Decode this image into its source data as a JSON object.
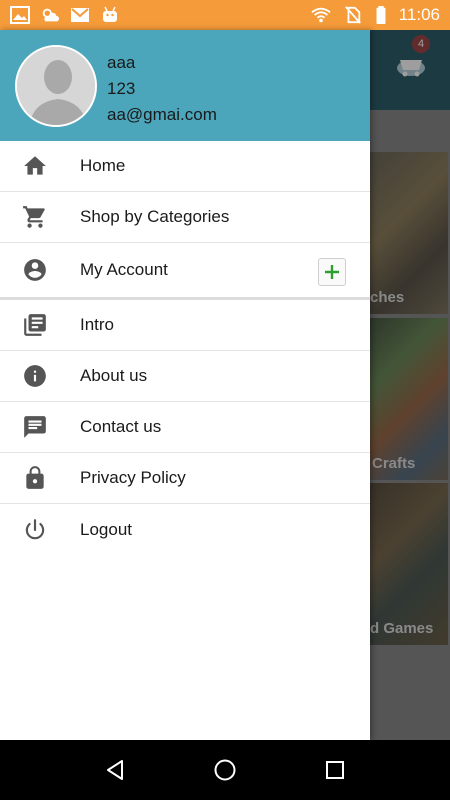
{
  "status_bar": {
    "time": "11:06",
    "left_icons": [
      "image-icon",
      "weather-icon",
      "gmail-icon",
      "android-icon"
    ],
    "right_icons": [
      "wifi-icon",
      "no-sim-icon",
      "battery-icon"
    ],
    "color": "#f59b3a"
  },
  "background_app": {
    "cart_badge": "4",
    "tiles": [
      {
        "label": "ches"
      },
      {
        "label": "Crafts"
      },
      {
        "label": "d Games"
      }
    ]
  },
  "drawer": {
    "header_color": "#4ba6bb",
    "user": {
      "name": "aaa",
      "phone": "123",
      "email": "aa@gmai.com"
    },
    "items": [
      {
        "label": "Home",
        "icon": "home-icon"
      },
      {
        "label": "Shop by Categories",
        "icon": "cart-icon"
      },
      {
        "label": "My Account",
        "icon": "account-circle-icon",
        "action_icon": "plus-icon"
      },
      {
        "label": "Intro",
        "icon": "library-books-icon"
      },
      {
        "label": "About us",
        "icon": "info-icon"
      },
      {
        "label": "Contact us",
        "icon": "message-icon"
      },
      {
        "label": "Privacy Policy",
        "icon": "lock-icon"
      },
      {
        "label": "Logout",
        "icon": "power-icon"
      }
    ]
  },
  "nav_bar": {
    "buttons": [
      "back-icon",
      "home-circle-icon",
      "recents-icon"
    ]
  }
}
